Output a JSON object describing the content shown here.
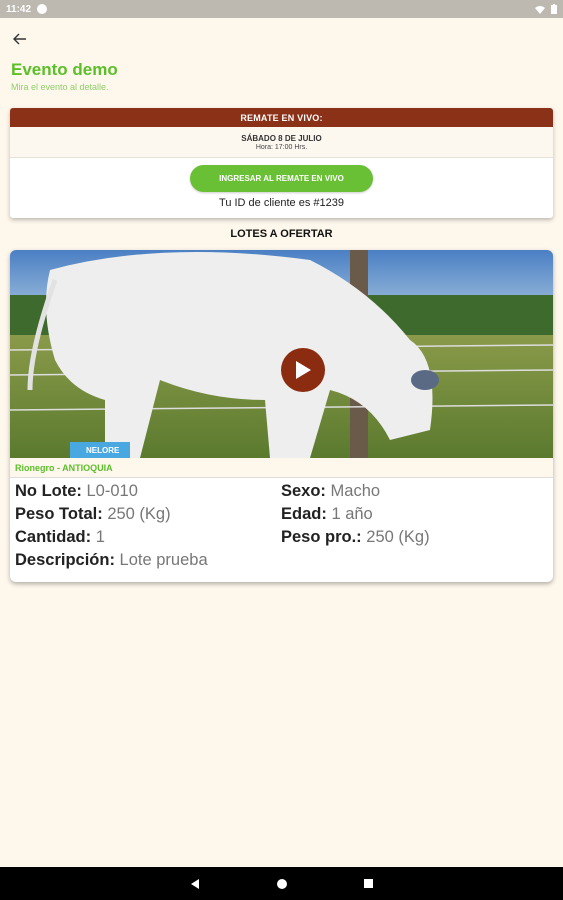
{
  "status_bar": {
    "time": "11:42"
  },
  "header": {
    "title": "Evento demo",
    "subtitle": "Mira el evento al detalle."
  },
  "event": {
    "header_label": "REMATE EN VIVO:",
    "date": "SÁBADO 8 DE JULIO",
    "hour": "Hora: 17:00 Hrs.",
    "enter_button": "INGRESAR AL REMATE EN VIVO",
    "client_id": "Tu ID de cliente es #1239"
  },
  "lots_section_title": "LOTES A OFERTAR",
  "lot": {
    "media_badge": "NELORE",
    "location": "Rionegro - ANTIOQUIA",
    "fields": {
      "no_lote_label": "No Lote:",
      "no_lote_value": "L0-010",
      "sexo_label": "Sexo:",
      "sexo_value": "Macho",
      "peso_total_label": "Peso Total:",
      "peso_total_value": "250 (Kg)",
      "edad_label": "Edad:",
      "edad_value": "1 año",
      "cantidad_label": "Cantidad:",
      "cantidad_value": "1",
      "peso_pro_label": "Peso pro.:",
      "peso_pro_value": "250 (Kg)",
      "descripcion_label": "Descripción:",
      "descripcion_value": "Lote prueba"
    }
  },
  "colors": {
    "accent_green": "#5cbf2a",
    "button_green": "#69c034",
    "header_brown": "#8b3118",
    "background": "#fdf7ec"
  },
  "icons": {
    "back": "arrow-left-icon",
    "play": "play-icon",
    "nav_back": "triangle-back-icon",
    "nav_home": "circle-home-icon",
    "nav_recents": "square-recents-icon"
  }
}
